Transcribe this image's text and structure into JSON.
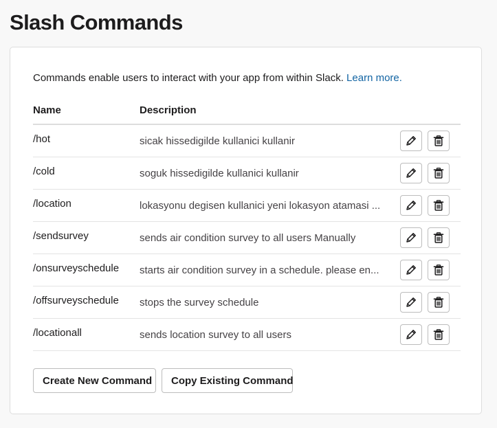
{
  "header": {
    "title": "Slash Commands"
  },
  "intro": {
    "text": "Commands enable users to interact with your app from within Slack.",
    "link_label": "Learn more."
  },
  "table": {
    "columns": {
      "name": "Name",
      "description": "Description"
    },
    "rows": [
      {
        "name": "/hot",
        "description": "sicak hissedigilde kullanici kullanir"
      },
      {
        "name": "/cold",
        "description": "soguk hissedigilde kullanici kullanir"
      },
      {
        "name": "/location",
        "description": "lokasyonu degisen kullanici yeni lokasyon atamasi ..."
      },
      {
        "name": "/sendsurvey",
        "description": "sends air condition survey to all users Manually"
      },
      {
        "name": "/onsurveyschedule",
        "description": "starts air condition survey in a schedule. please en..."
      },
      {
        "name": "/offsurveyschedule",
        "description": "stops the survey schedule"
      },
      {
        "name": "/locationall",
        "description": "sends location survey to all users"
      }
    ],
    "row_actions": {
      "edit_icon": "pencil-icon",
      "delete_icon": "trash-icon"
    }
  },
  "actions": {
    "create_label": "Create New Command",
    "copy_label": "Copy Existing Command"
  },
  "colors": {
    "link": "#1264a3",
    "text": "#1d1c1d",
    "muted_text": "#454245",
    "border": "#dddddd",
    "background": "#f8f8f8"
  }
}
